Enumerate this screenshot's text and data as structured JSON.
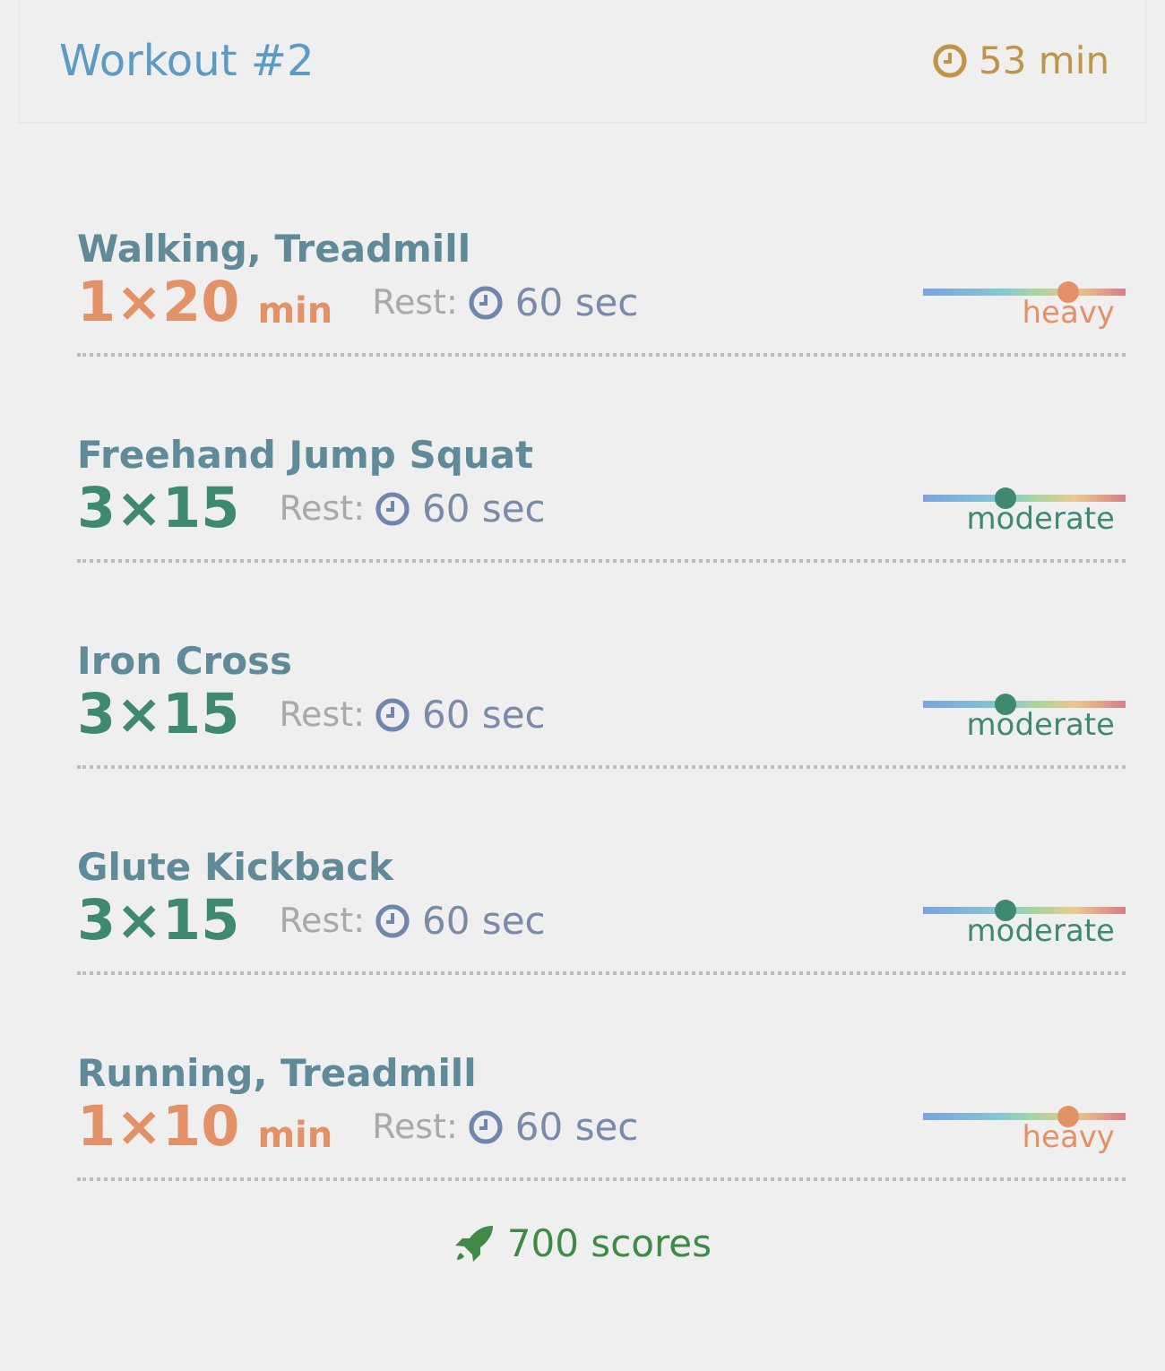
{
  "header": {
    "title": "Workout #2",
    "duration": "53 min"
  },
  "exercises": [
    {
      "name": "Walking, Treadmill",
      "sets": "1×20",
      "unit": "min",
      "rest_label": "Rest:",
      "rest": "60 sec",
      "intensity": {
        "kind": "heavy",
        "label": "heavy",
        "level": 0.72
      }
    },
    {
      "name": "Freehand Jump Squat",
      "sets": "3×15",
      "rest_label": "Rest:",
      "rest": "60 sec",
      "intensity": {
        "kind": "moderate",
        "label": "moderate",
        "level": 0.41
      }
    },
    {
      "name": "Iron Cross",
      "sets": "3×15",
      "rest_label": "Rest:",
      "rest": "60 sec",
      "intensity": {
        "kind": "moderate",
        "label": "moderate",
        "level": 0.41
      }
    },
    {
      "name": "Glute Kickback",
      "sets": "3×15",
      "rest_label": "Rest:",
      "rest": "60 sec",
      "intensity": {
        "kind": "moderate",
        "label": "moderate",
        "level": 0.41
      }
    },
    {
      "name": "Running, Treadmill",
      "sets": "1×10",
      "unit": "min",
      "rest_label": "Rest:",
      "rest": "60 sec",
      "intensity": {
        "kind": "heavy",
        "label": "heavy",
        "level": 0.72
      }
    }
  ],
  "footer": {
    "score": "700 scores"
  }
}
